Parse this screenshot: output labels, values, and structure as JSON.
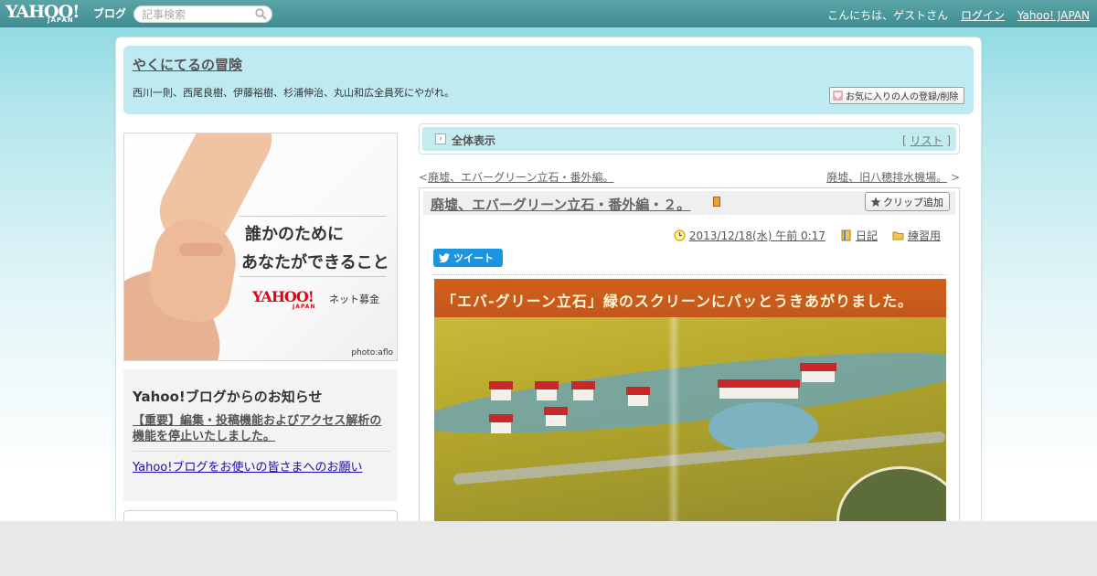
{
  "topbar": {
    "logo_text": "YAHOO!",
    "logo_sub": "JAPAN",
    "logo_blog": "ブログ",
    "search_placeholder": "記事検索",
    "greeting": "こんにちは、ゲストさん",
    "login": "ログイン",
    "yahoo_japan": "Yahoo! JAPAN"
  },
  "blog": {
    "title": "やくにてるの冒険",
    "description": "西川一則、西尾良樹、伊藤裕樹、杉浦伸治、丸山和広全員死にやがれ。",
    "fav_button": "お気に入りの人の登録/削除"
  },
  "ad": {
    "line1": "誰かのために",
    "line2": "あなたができること",
    "brand": "YAHOO!",
    "brand_sub": "JAPAN",
    "brand_service": "ネット募金",
    "credit": "photo:aflo"
  },
  "notice": {
    "heading": "Yahoo!ブログからのお知らせ",
    "item1": "【重要】編集・投稿機能およびアクセス解析の機能を停止いたしました。",
    "item2": "Yahoo!ブログをお使いの皆さまへのお願い"
  },
  "allbar": {
    "label": "全体表示",
    "list_prefix": "[",
    "list": "リスト",
    "list_suffix": "]"
  },
  "nav": {
    "prev_mark": "<",
    "prev": "廃墟、エバーグリーン立石・番外編。",
    "next": "廃墟、旧八穂排水機場。",
    "next_mark": ">"
  },
  "article": {
    "title": "廃墟、エバーグリーン立石・番外編・２。",
    "clip_button": "クリップ追加",
    "date": "2013/12/18(水) 午前 0:17",
    "category": "日記",
    "folder": "練習用",
    "tweet": "ツイート",
    "photo_caption": "「エバ-グリーン立石」緑のスクリーンにパッとうきあがりました。"
  },
  "colors": {
    "topbar": "#4a9598",
    "header_bg": "#bfeaf2",
    "allbar_bg": "#c3ecf1",
    "tweet": "#1b95e0"
  }
}
